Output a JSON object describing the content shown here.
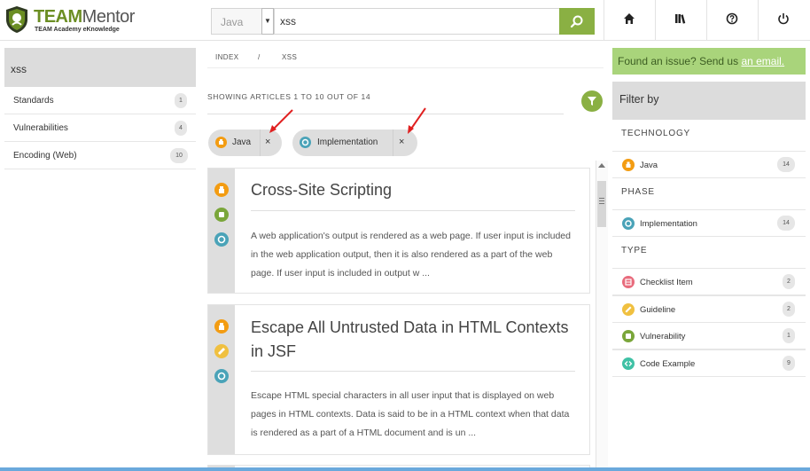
{
  "brand": {
    "title_part1": "TEAM",
    "title_part2": "Mentor",
    "subtitle": "TEAM Academy eKnowledge"
  },
  "search": {
    "language": "Java",
    "query": "xss"
  },
  "header_icons": [
    "home-icon",
    "library-icon",
    "help-icon",
    "power-icon"
  ],
  "left_sidebar": {
    "query": "xss",
    "items": [
      {
        "label": "Standards",
        "count": "1"
      },
      {
        "label": "Vulnerabilities",
        "count": "4"
      },
      {
        "label": "Encoding (Web)",
        "count": "10"
      }
    ]
  },
  "breadcrumb": {
    "index": "INDEX",
    "sep": "/",
    "current": "XSS"
  },
  "results": {
    "showing": "SHOWING ARTICLES 1 TO 10 OUT OF 14"
  },
  "chips": [
    {
      "label": "Java",
      "remove": "×",
      "color": "#f39c12"
    },
    {
      "label": "Implementation",
      "remove": "×",
      "color": "#4aa3b8"
    }
  ],
  "articles": [
    {
      "title": "Cross-Site Scripting",
      "body": "A web application's output is rendered as a web page. If user input is included in the web application output, then it is also rendered as a part of the web page. If user input is included in output w ...",
      "icons": [
        "java-icon",
        "vulnerability-icon",
        "implementation-icon"
      ]
    },
    {
      "title": "Escape All Untrusted Data in HTML Contexts in JSF",
      "body": "Escape HTML special characters in all user input that is displayed on web pages in HTML contexts. Data is said to be in a HTML context when that data is rendered as a part of a HTML document and is un ...",
      "icons": [
        "java-icon",
        "guideline-icon",
        "implementation-icon"
      ]
    }
  ],
  "right_sidebar": {
    "issue_text": "Found an issue? Send us ",
    "issue_link": "an email.",
    "filter_title": "Filter by",
    "technology": {
      "heading": "TECHNOLOGY",
      "items": [
        {
          "label": "Java",
          "count": "14",
          "color": "#f39c12"
        }
      ]
    },
    "phase": {
      "heading": "PHASE",
      "items": [
        {
          "label": "Implementation",
          "count": "14",
          "color": "#4aa3b8"
        }
      ]
    },
    "type": {
      "heading": "TYPE",
      "items": [
        {
          "label": "Checklist Item",
          "count": "2",
          "color": "#e86b7c"
        },
        {
          "label": "Guideline",
          "count": "2",
          "color": "#f0c040"
        },
        {
          "label": "Vulnerability",
          "count": "1",
          "color": "#7aa63a"
        },
        {
          "label": "Code Example",
          "count": "9",
          "color": "#3fc1a5"
        }
      ]
    }
  },
  "colors": {
    "accent": "#8ab043",
    "issue_bg": "#a9d47b",
    "annotation_arrow": "#e02020"
  }
}
